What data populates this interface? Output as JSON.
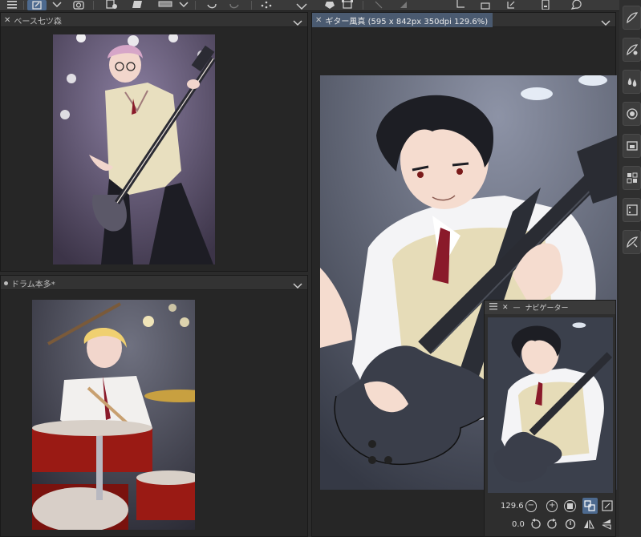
{
  "panels": {
    "top_left": {
      "tab_title": "ベース七ツ森"
    },
    "bottom_left": {
      "tab_title": "ドラム本多*"
    },
    "main": {
      "tab_title": "ギター風真 (595 x 842px 350dpi 129.6%)"
    }
  },
  "navigator": {
    "title": "ナビゲーター",
    "zoom_value": "129.6",
    "rotation_value": "0.0"
  },
  "toolbar": {
    "icons": [
      "menu-icon",
      "edit-icon",
      "chevron-down-icon",
      "camera-icon",
      "new-canvas-icon",
      "fill-icon",
      "layer-icon",
      "chevron-down-icon",
      "undo-icon",
      "redo-icon",
      "loading-icon",
      "clear-icon",
      "transform-icon",
      "select-icon",
      "crop-icon",
      "canvas-icon",
      "phone-icon",
      "chat-icon"
    ]
  },
  "dock": {
    "icons": [
      "brush-icon",
      "brush-settings-icon",
      "color-icon",
      "circle-icon",
      "folder-icon",
      "layers-icon",
      "film-icon",
      "material-icon"
    ]
  },
  "colors": {
    "accent": "#4d6a8f",
    "panel_bg": "#262626",
    "tab_active": "#4a5a70"
  }
}
